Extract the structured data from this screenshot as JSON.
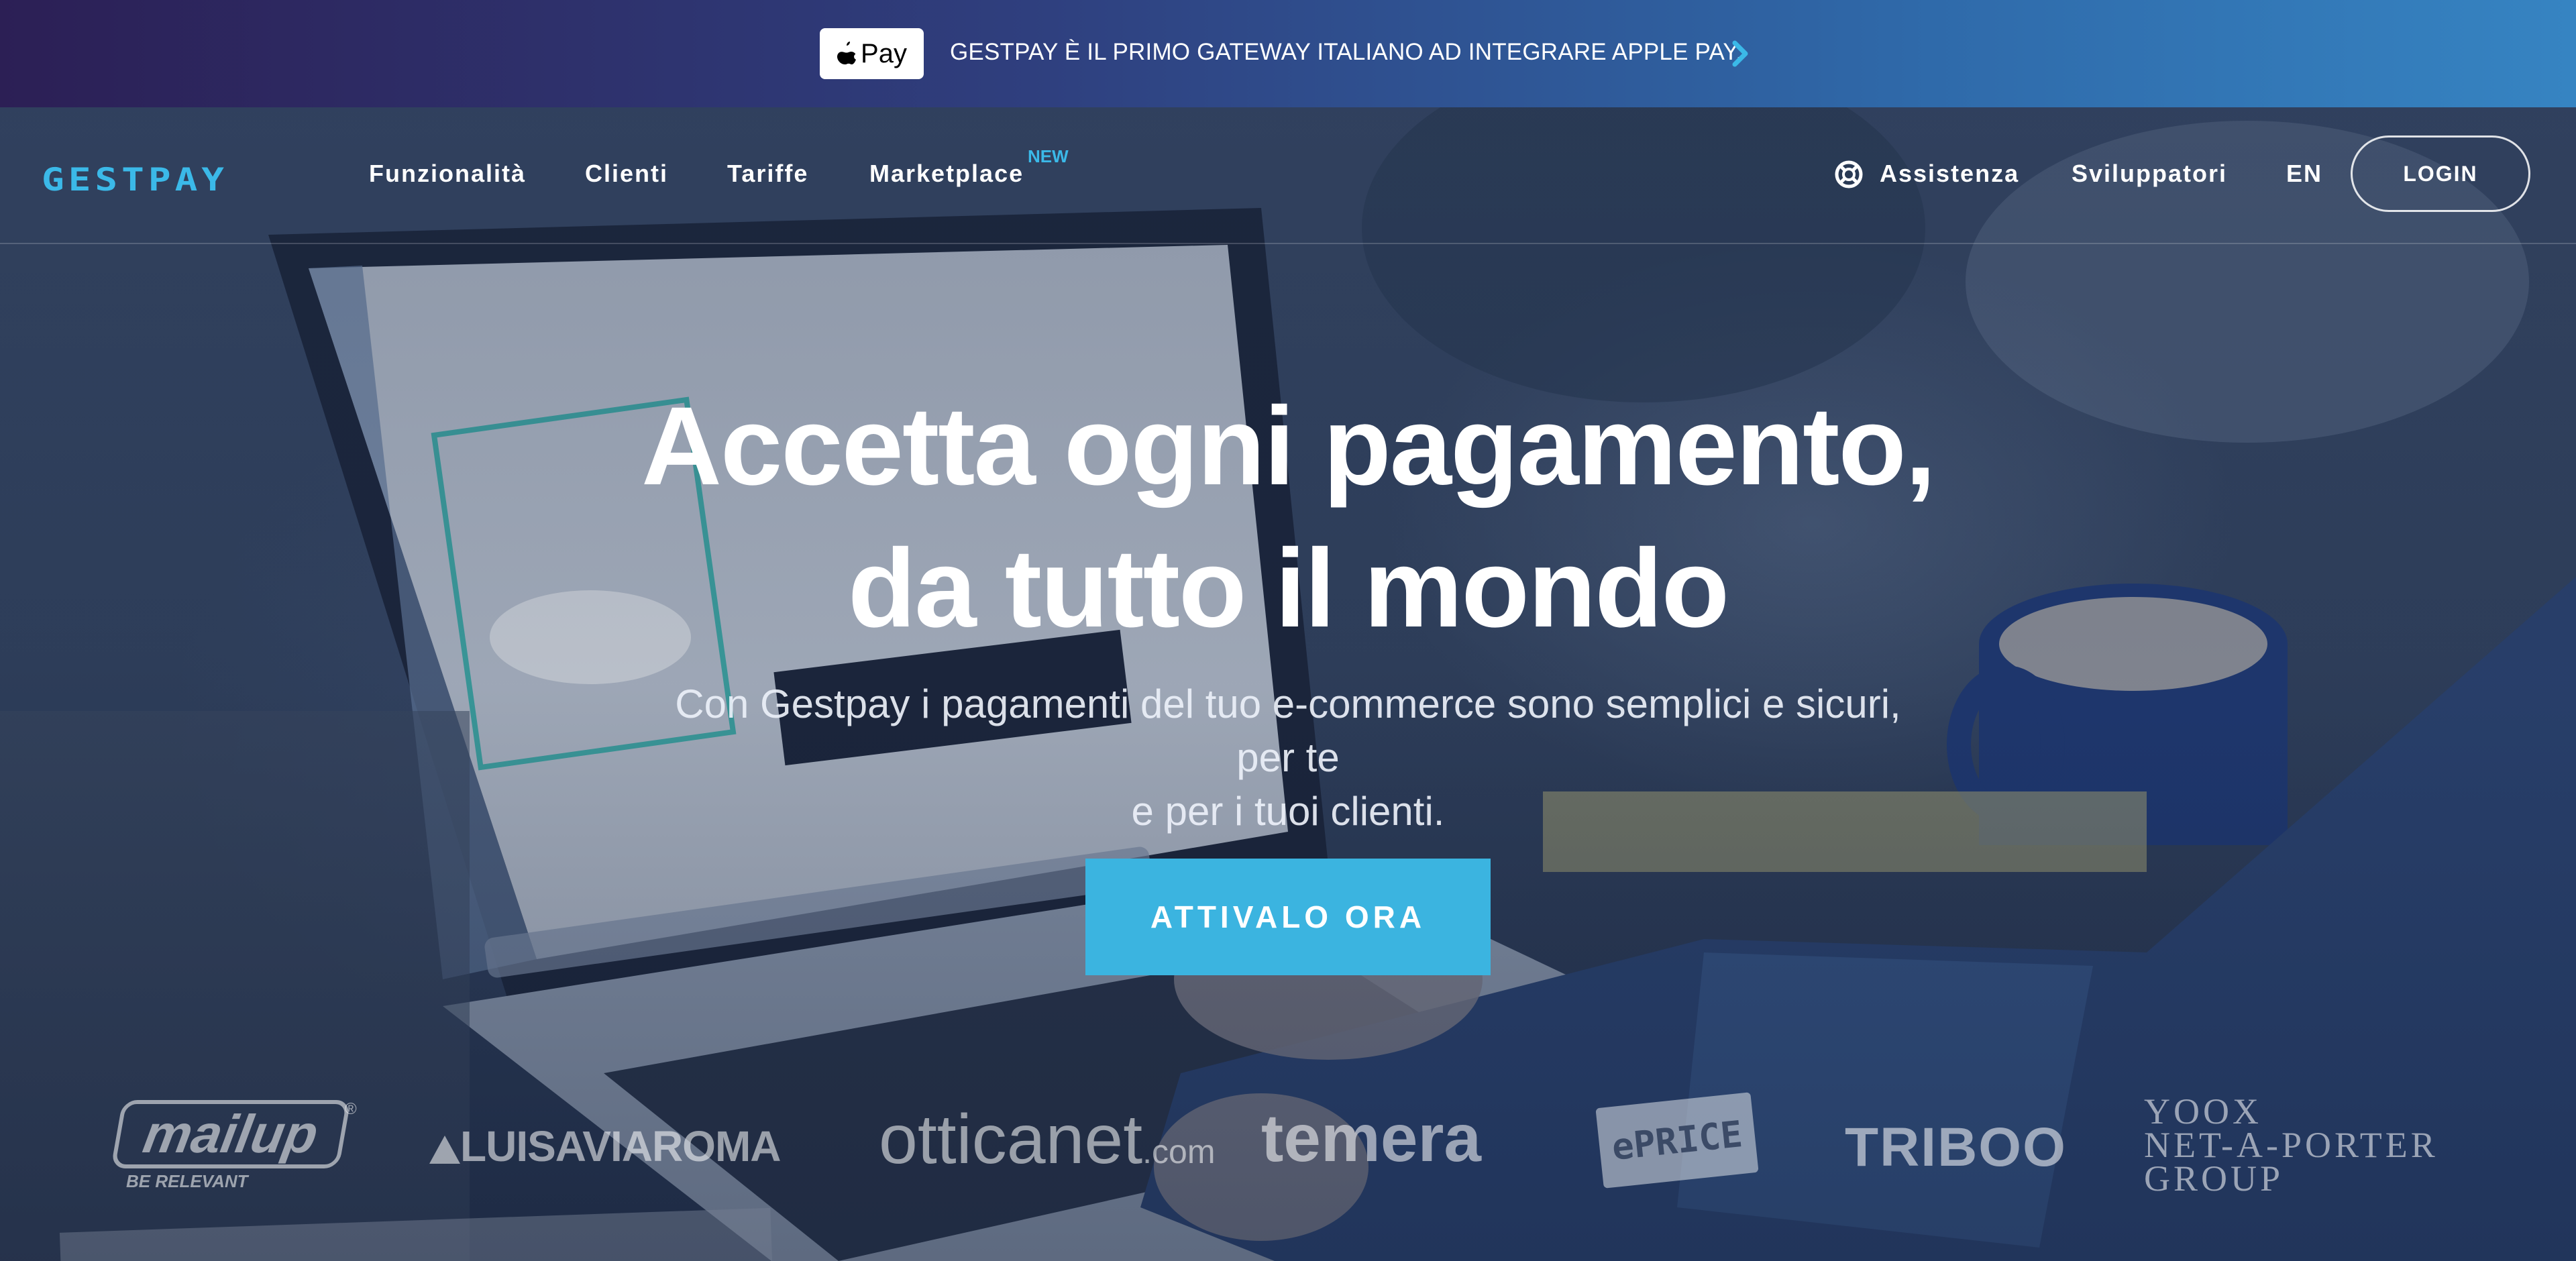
{
  "banner": {
    "apple_pay_label": "Pay",
    "text": "GESTPAY È IL PRIMO GATEWAY ITALIANO AD INTEGRARE APPLE PAY."
  },
  "nav": {
    "logo": "GESTPAY",
    "items": [
      {
        "label": "Funzionalità"
      },
      {
        "label": "Clienti"
      },
      {
        "label": "Tariffe"
      },
      {
        "label": "Marketplace"
      }
    ],
    "new_badge": "NEW",
    "assistenza": "Assistenza",
    "sviluppatori": "Sviluppatori",
    "language": "EN",
    "login": "LOGIN"
  },
  "hero": {
    "headline_line1": "Accetta ogni pagamento,",
    "headline_line2": "da tutto il mondo",
    "subtitle_line1": "Con Gestpay i pagamenti del tuo e-commerce sono semplici e sicuri, per te",
    "subtitle_line2": "e per i tuoi clienti.",
    "cta": "ATTIVALO ORA"
  },
  "clients": {
    "mailup": "mailup",
    "mailup_reg": "®",
    "mailup_tagline": "BE RELEVANT",
    "luisaviaroma": "LUISAVIAROMA",
    "otticanet": "otticanet",
    "otticanet_suffix": ".com",
    "temera": "temera",
    "eprice": "ePRICE",
    "triboo": "TRIBOO",
    "yoox_line1": "YOOX",
    "yoox_line2": "NET-A-PORTER",
    "yoox_line3": "GROUP"
  },
  "colors": {
    "accent": "#3bb4e0",
    "logo": "#3bb9e8",
    "banner_start": "#2c1f55",
    "banner_end": "#3684c2"
  },
  "icons": {
    "apple": "apple-icon",
    "chevron": "chevron-right-icon",
    "help": "lifebuoy-icon",
    "luisaviaroma_triangle": "triangle-icon"
  }
}
